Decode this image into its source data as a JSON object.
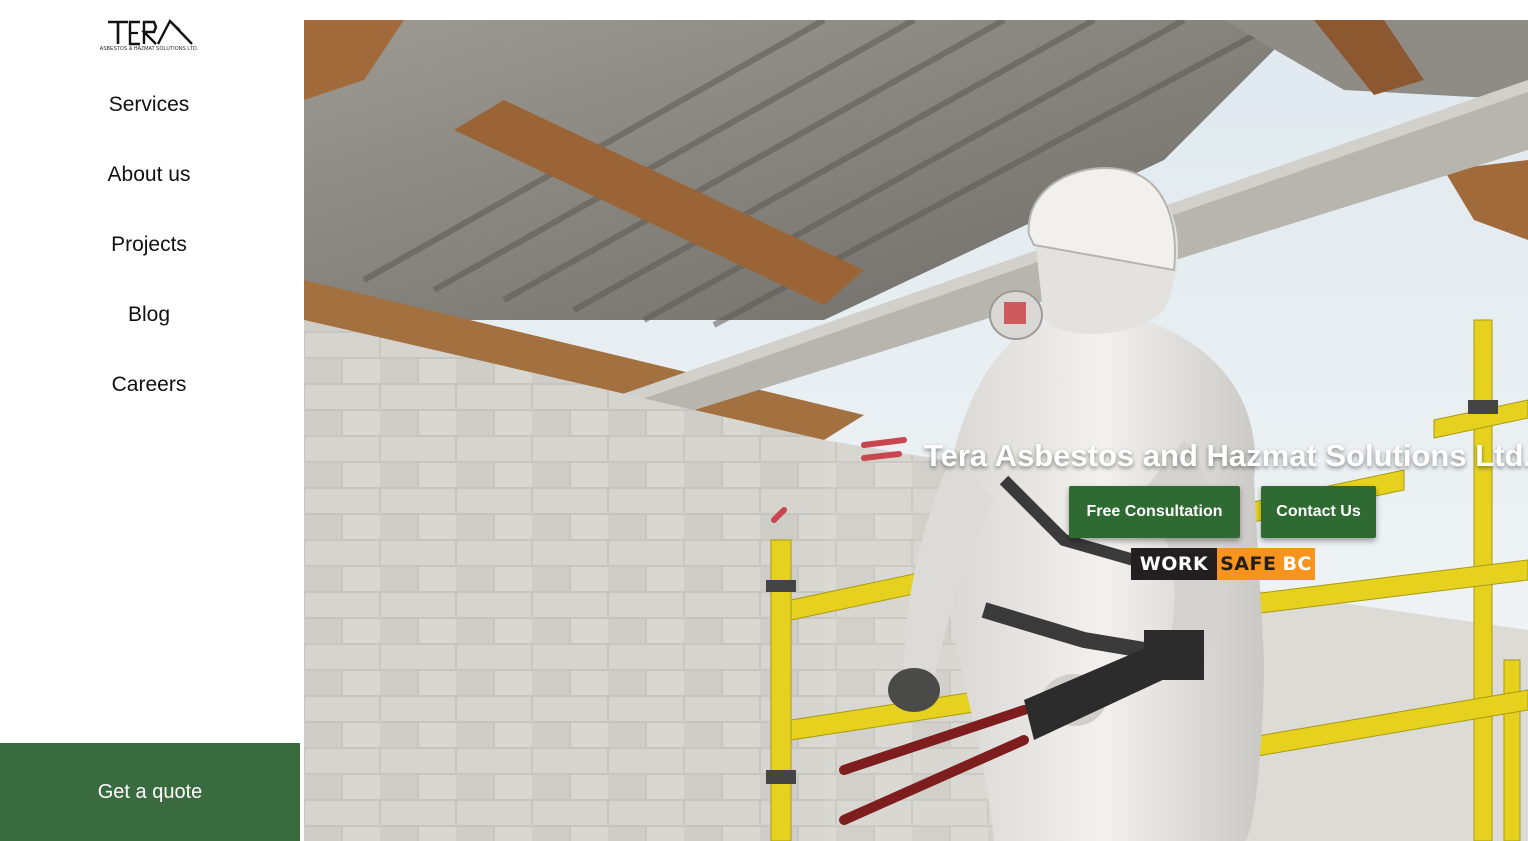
{
  "brand": {
    "logo_text": "TERA",
    "tagline": "ASBESTOS & HAZMAT SOLUTIONS LTD."
  },
  "nav": {
    "items": [
      {
        "label": "Services"
      },
      {
        "label": "About us"
      },
      {
        "label": "Projects"
      },
      {
        "label": "Blog"
      },
      {
        "label": "Careers"
      }
    ]
  },
  "quote_button": {
    "label": "Get a quote"
  },
  "hero": {
    "title": "Tera Asbestos and Hazmat Solutions Ltd.",
    "primary_button": "Free Consultation",
    "secondary_button": "Contact Us",
    "badge": {
      "part1": "WORK",
      "part2": "SAFE",
      "part3": "BC"
    }
  },
  "colors": {
    "accent_green": "#3a6b3e",
    "button_green": "#2f6a33",
    "worksafe_orange": "#f7941d",
    "worksafe_dark": "#231f20"
  }
}
